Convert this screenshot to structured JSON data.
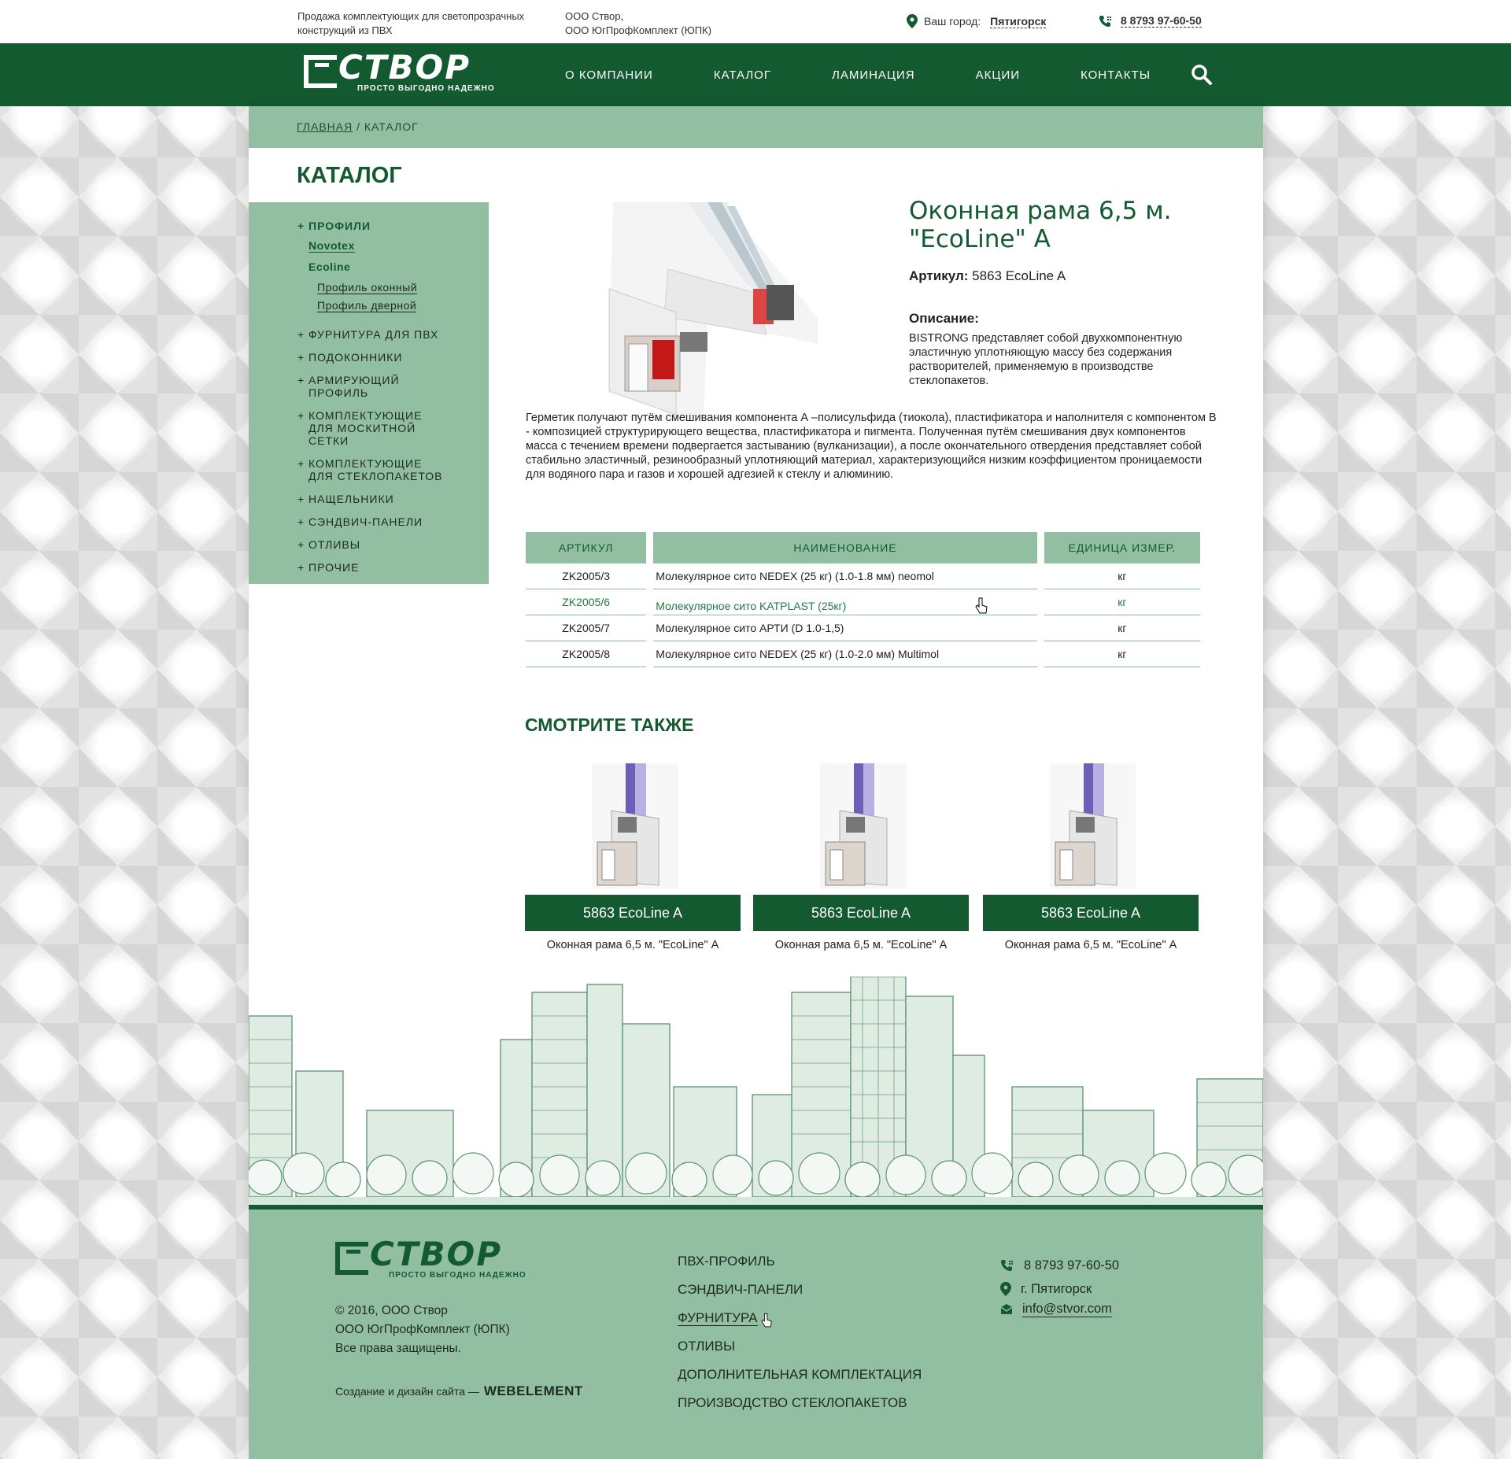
{
  "topbar": {
    "tagline": "Продажа комплектующих для светопрозрачных конструкций из ПВХ",
    "company_1": "ООО Створ,",
    "company_2": "ООО ЮгПрофКомплект (ЮПК)",
    "city_label": "Ваш город:",
    "city": "Пятигорск",
    "phone": "8 8793  97-60-50"
  },
  "logo": {
    "word": "СТВОР",
    "slogan": "ПРОСТО ВЫГОДНО НАДЕЖНО"
  },
  "nav": [
    "О КОМПАНИИ",
    "КАТАЛОГ",
    "ЛАМИНАЦИЯ",
    "АКЦИИ",
    "КОНТАКТЫ"
  ],
  "breadcrumb": {
    "home": "ГЛАВНАЯ",
    "sep": "/",
    "current": "КАТАЛОГ"
  },
  "page_title": "КАТАЛОГ",
  "sidebar": {
    "profiles": "ПРОФИЛИ",
    "novotex": "Novotex",
    "ecoline": "Ecoline",
    "profile_window": "Профиль оконный",
    "profile_door": "Профиль дверной",
    "items": [
      "ФУРНИТУРА ДЛЯ ПВХ",
      "ПОДОКОННИКИ",
      "АРМИРУЮЩИЙ ПРОФИЛЬ",
      "КОМПЛЕКТУЮЩИЕ ДЛЯ МОСКИТНОЙ СЕТКИ",
      "КОМПЛЕКТУЮЩИЕ ДЛЯ СТЕКЛОПАКЕТОВ",
      "НАЩЕЛЬНИКИ",
      "СЭНДВИЧ-ПАНЕЛИ",
      "ОТЛИВЫ",
      "ПРОЧИЕ"
    ]
  },
  "product": {
    "title": "Оконная рама 6,5 м. \"EcoLine\" А",
    "article_label": "Артикул:",
    "article": "5863 EcoLine A",
    "desc_label": "Описание:",
    "desc_1": "BISTRONG представляет собой двухкомпонентную эластичную уплотняющую массу без содержания растворителей, применяемую в производстве стеклопакетов.",
    "desc_2": "Герметик получают путём смешивания компонента А –полисульфида (тиокола), пластификатора и наполнителя с компонентом В - композицией структурирующего вещества, пластификатора и пигмента. Полученная путём смешивания двух компонентов масса с течением времени подвергается застыванию (вулканизации), а после окончательного отвердения представляет собой стабильно эластичный, резинообразный уплотняющий материал, характеризующийся низким коэффициентом проницаемости для водяного пара и газов и хорошей адгезией к стеклу и алюминию."
  },
  "table": {
    "headers": [
      "АРТИКУЛ",
      "НАИМЕНОВАНИЕ",
      "ЕДИНИЦА ИЗМЕР."
    ],
    "rows": [
      [
        "ZK2005/3",
        "Молекулярное сито NEDEX (25 кг) (1.0-1.8 мм) neomol",
        "кг"
      ],
      [
        "ZK2005/6",
        "Молекулярное сито KATPLAST (25кг)",
        "кг"
      ],
      [
        "ZK2005/7",
        "Молекулярное сито АРТИ (D 1.0-1,5)",
        "кг"
      ],
      [
        "ZK2005/8",
        "Молекулярное сито NEDEX (25 кг) (1.0-2.0 мм) Multimol",
        "кг"
      ]
    ]
  },
  "see_also": {
    "title": "СМОТРИТЕ ТАКЖЕ",
    "cards": [
      {
        "button": "5863 EcoLine A",
        "caption": "Оконная рама 6,5 м. \"EcoLine\" А"
      },
      {
        "button": "5863 EcoLine A",
        "caption": "Оконная рама 6,5 м. \"EcoLine\" А"
      },
      {
        "button": "5863 EcoLine A",
        "caption": "Оконная рама 6,5 м. \"EcoLine\" А"
      }
    ]
  },
  "footer": {
    "copy_1": "© 2016,  ООО Створ",
    "copy_2": "ООО ЮгПрофКомплект (ЮПК)",
    "copy_3": "Все права защищены.",
    "created": "Создание и дизайн сайта —",
    "studio": "WEBELEMENT",
    "menu": [
      "ПВХ-ПРОФИЛЬ",
      "СЭНДВИЧ-ПАНЕЛИ",
      "ФУРНИТУРА",
      "ОТЛИВЫ",
      "ДОПОЛНИТЕЛЬНАЯ КОМПЛЕКТАЦИЯ",
      "ПРОИЗВОДСТВО СТЕКЛОПАКЕТОВ"
    ],
    "phone": "8 8793  97-60-50",
    "city": "г. Пятигорск",
    "email": "info@stvor.com"
  },
  "colors": {
    "brand": "#135a30",
    "light": "#92bfa1"
  },
  "icons": [
    "map-pin-icon",
    "phone-icon",
    "search-icon",
    "mail-icon",
    "cursor-hand-icon"
  ]
}
